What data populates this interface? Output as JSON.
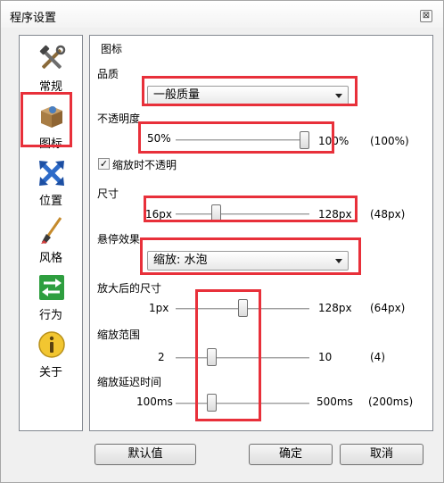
{
  "window": {
    "title": "程序设置",
    "close_glyph": "⊠"
  },
  "sidebar": {
    "items": [
      {
        "label": "常规",
        "icon": "tools-icon"
      },
      {
        "label": "图标",
        "icon": "package-icon"
      },
      {
        "label": "位置",
        "icon": "move-arrows-icon"
      },
      {
        "label": "风格",
        "icon": "brush-icon"
      },
      {
        "label": "行为",
        "icon": "exchange-arrows-icon"
      },
      {
        "label": "关于",
        "icon": "info-icon"
      }
    ],
    "selected": "图标"
  },
  "panel": {
    "group_title": "图标",
    "quality": {
      "label": "品质",
      "value": "一般质量"
    },
    "opacity": {
      "label": "不透明度",
      "min": "50%",
      "max": "100%",
      "current": "(100%)",
      "level_fraction": 1.0
    },
    "checkbox": {
      "label": "缩放时不透明",
      "checked": true,
      "mark": "✓"
    },
    "size": {
      "label": "尺寸",
      "min": "16px",
      "max": "128px",
      "current": "(48px)",
      "level_fraction": 0.29
    },
    "hover": {
      "label": "悬停效果",
      "value": "缩放: 水泡"
    },
    "zoom_size": {
      "label": "放大后的尺寸",
      "min": "1px",
      "max": "128px",
      "current": "(64px)",
      "level_fraction": 0.5
    },
    "zoom_range": {
      "label": "缩放范围",
      "min": "2",
      "max": "10",
      "current": "(4)",
      "level_fraction": 0.25
    },
    "zoom_delay": {
      "label": "缩放延迟时间",
      "min": "100ms",
      "max": "500ms",
      "current": "(200ms)",
      "level_fraction": 0.25
    }
  },
  "buttons": {
    "default": "默认值",
    "ok": "确定",
    "cancel": "取消"
  },
  "colors": {
    "highlight": "#e8303a"
  }
}
